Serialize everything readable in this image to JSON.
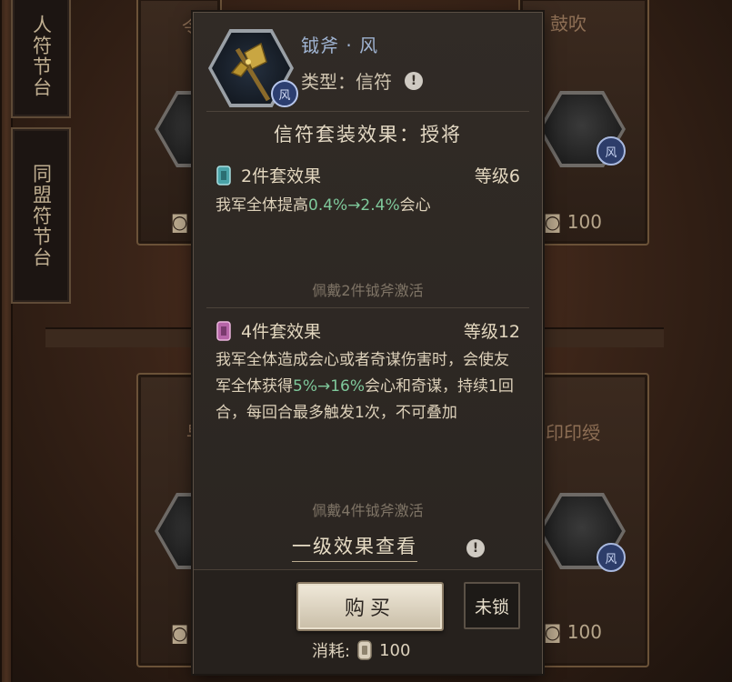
{
  "background": {
    "side_tabs": [
      "人符节台",
      "同盟符节台"
    ],
    "cards": [
      {
        "top_label": "令"
      },
      {
        "top_label": "鼓吹"
      },
      {
        "cost": "100"
      },
      {
        "cost": "100"
      },
      {
        "top_label": "印印绶"
      },
      {
        "cost": "100"
      }
    ],
    "badge_letter": "风"
  },
  "item": {
    "name": "钺斧 · 风",
    "type_label": "类型：信符",
    "badge_letter": "风",
    "icon": "axe-icon"
  },
  "set": {
    "title": "信符套装效果：授将",
    "tiers": [
      {
        "head": "2件套效果",
        "level": "等级6",
        "desc_prefix": "我军全体提高",
        "desc_highlight": "0.4%→2.4%",
        "desc_suffix": "会心",
        "activate": "佩戴2件钺斧激活",
        "gem_color": "#4aa3a8"
      },
      {
        "head": "4件套效果",
        "level": "等级12",
        "desc_prefix": "我军全体造成会心或者奇谋伤害时，会使友军全体获得",
        "desc_highlight": "5%→16%",
        "desc_suffix": "会心和奇谋，持续1回合，每回合最多触发1次，不可叠加",
        "activate": "佩戴4件钺斧激活",
        "gem_color": "#b765a8"
      }
    ]
  },
  "actions": {
    "level_view": "一级效果查看",
    "buy_label": "购买",
    "lock_label": "未锁",
    "cost_label": "消耗:",
    "cost_value": "100"
  },
  "colors": {
    "highlight": "#7fc99b",
    "item_name": "#9fb3d1"
  }
}
